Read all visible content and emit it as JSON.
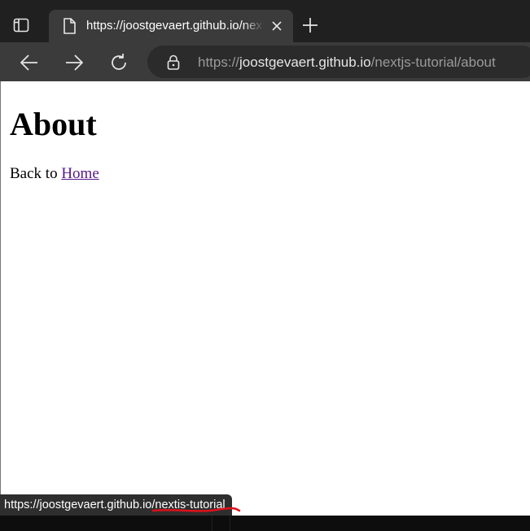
{
  "browser": {
    "tab": {
      "title": "https://joostgevaert.github.io/nextjs-tutorial/about"
    },
    "address": {
      "scheme": "https://",
      "host": "joostgevaert.github.io",
      "path": "/nextjs-tutorial/about"
    },
    "colors": {
      "tabstrip": "#202020",
      "toolbar": "#3b3b3b",
      "addressbar": "#2b2b2b"
    }
  },
  "page": {
    "heading": "About",
    "back_text": "Back to ",
    "home_link": "Home"
  },
  "status_bar": {
    "url_part1": "https://joostgevaert.github.io/",
    "url_part2": "nextis-tutorial",
    "annotation_color": "#e0101a"
  },
  "icons": [
    "tab-actions-icon",
    "page-icon",
    "close-icon",
    "plus-icon",
    "arrow-left-icon",
    "arrow-right-icon",
    "refresh-icon",
    "lock-icon"
  ]
}
